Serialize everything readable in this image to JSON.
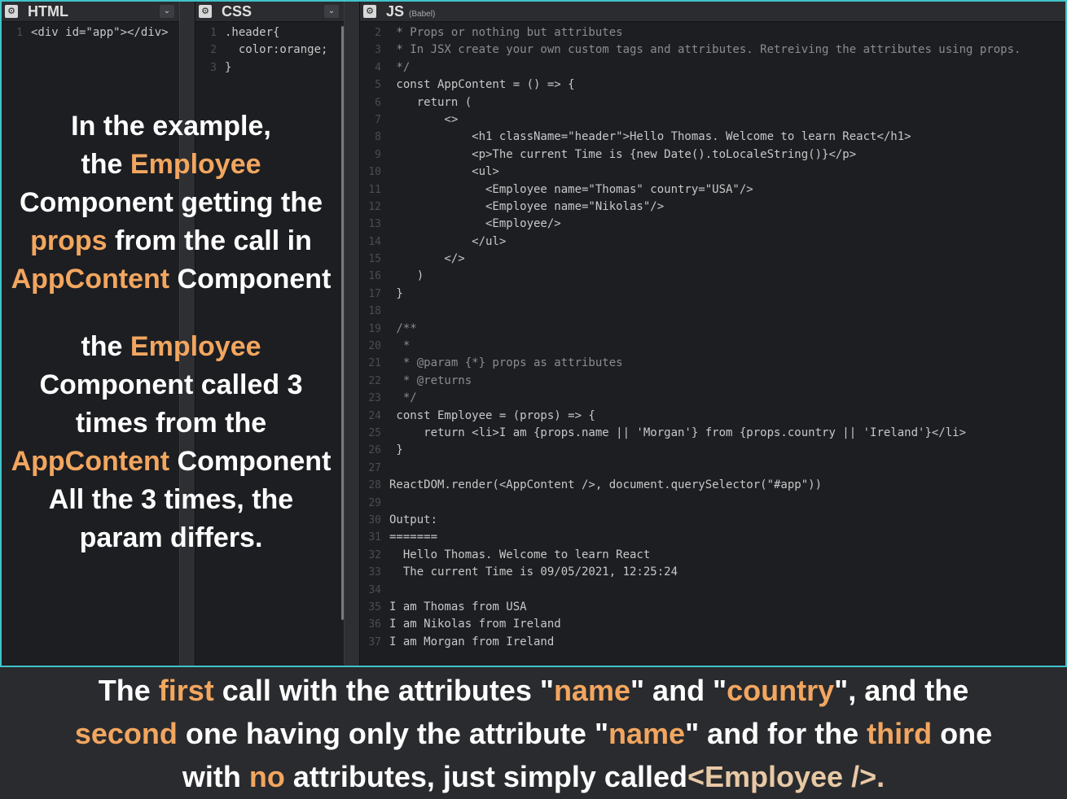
{
  "panels": {
    "html": {
      "title": "HTML",
      "lines": [
        {
          "n": "1",
          "text": "<div id=\"app\"></div>"
        }
      ]
    },
    "css": {
      "title": "CSS",
      "lines": [
        {
          "n": "1",
          "text": ".header{"
        },
        {
          "n": "2",
          "text": "  color:orange;"
        },
        {
          "n": "3",
          "text": "}"
        }
      ]
    },
    "js": {
      "title": "JS",
      "subtitle": "(Babel)",
      "lines": [
        {
          "n": "2",
          "text": " * Props or nothing but attributes",
          "cls": "c-com"
        },
        {
          "n": "3",
          "text": " * In JSX create your own custom tags and attributes. Retreiving the attributes using props.",
          "cls": "c-com"
        },
        {
          "n": "4",
          "text": " */",
          "cls": "c-com"
        },
        {
          "n": "5",
          "text": " const AppContent = () => {"
        },
        {
          "n": "6",
          "text": "    return ("
        },
        {
          "n": "7",
          "text": "        <>"
        },
        {
          "n": "8",
          "text": "            <h1 className=\"header\">Hello Thomas. Welcome to learn React</h1>"
        },
        {
          "n": "9",
          "text": "            <p>The current Time is {new Date().toLocaleString()}</p>"
        },
        {
          "n": "10",
          "text": "            <ul>"
        },
        {
          "n": "11",
          "text": "              <Employee name=\"Thomas\" country=\"USA\"/>"
        },
        {
          "n": "12",
          "text": "              <Employee name=\"Nikolas\"/>"
        },
        {
          "n": "13",
          "text": "              <Employee/>"
        },
        {
          "n": "14",
          "text": "            </ul>"
        },
        {
          "n": "15",
          "text": "        </>"
        },
        {
          "n": "16",
          "text": "    )"
        },
        {
          "n": "17",
          "text": " }"
        },
        {
          "n": "18",
          "text": ""
        },
        {
          "n": "19",
          "text": " /**",
          "cls": "c-com"
        },
        {
          "n": "20",
          "text": "  *",
          "cls": "c-com"
        },
        {
          "n": "21",
          "text": "  * @param {*} props as attributes",
          "cls": "c-com"
        },
        {
          "n": "22",
          "text": "  * @returns",
          "cls": "c-com"
        },
        {
          "n": "23",
          "text": "  */",
          "cls": "c-com"
        },
        {
          "n": "24",
          "text": " const Employee = (props) => {"
        },
        {
          "n": "25",
          "text": "     return <li>I am {props.name || 'Morgan'} from {props.country || 'Ireland'}</li>"
        },
        {
          "n": "26",
          "text": " }"
        },
        {
          "n": "27",
          "text": ""
        },
        {
          "n": "28",
          "text": "ReactDOM.render(<AppContent />, document.querySelector(\"#app\"))"
        },
        {
          "n": "29",
          "text": ""
        },
        {
          "n": "30",
          "text": "Output:"
        },
        {
          "n": "31",
          "text": "======="
        },
        {
          "n": "32",
          "text": "  Hello Thomas. Welcome to learn React"
        },
        {
          "n": "33",
          "text": "  The current Time is 09/05/2021, 12:25:24"
        },
        {
          "n": "34",
          "text": ""
        },
        {
          "n": "35",
          "text": "I am Thomas from USA"
        },
        {
          "n": "36",
          "text": "I am Nikolas from Ireland"
        },
        {
          "n": "37",
          "text": "I am Morgan from Ireland"
        }
      ]
    }
  },
  "overlay": {
    "p1": {
      "a": "In the example,",
      "b": "the ",
      "b_hl": "Employee",
      "c": "Component getting the",
      "d_hl": "props",
      "d": " from the call in",
      "e_hl": "AppContent",
      "e": " Component"
    },
    "p2": {
      "a": "the ",
      "a_hl": "Employee",
      "b": "Component called  3",
      "c": "times from the",
      "d_hl": "AppContent",
      "d": " Component",
      "e": "All the 3 times, the",
      "f": "param differs."
    }
  },
  "bottom": {
    "s1": "The ",
    "h1": "first",
    "s2": " call with the attributes \"",
    "h2": "name",
    "s3": "\" and \"",
    "h3": "country",
    "s4": "\", and the",
    "h4": "second",
    "s5": " one having only the attribute \"",
    "h5": "name",
    "s6": "\" and for the ",
    "h6": "third",
    "s7": " one",
    "s8": "with ",
    "h7": "no",
    "s9": " attributes, just simply called",
    "tag": "<Employee />."
  },
  "colors": {
    "accent": "#f2a65f",
    "frame": "#3fc4c9"
  }
}
